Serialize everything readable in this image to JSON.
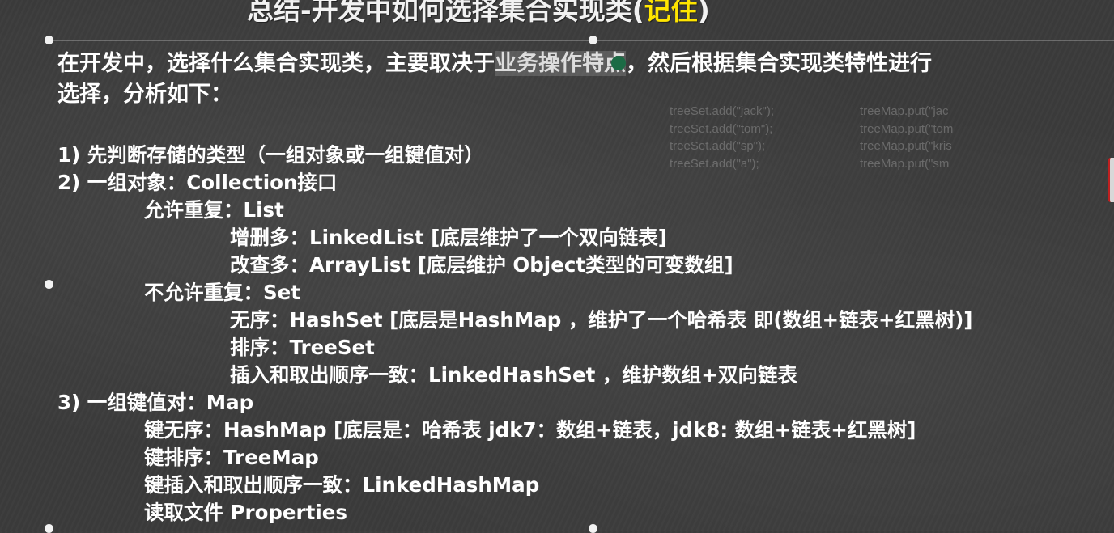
{
  "title": {
    "main": "总结-开发中如何选择集合实现类(",
    "highlight": "记住",
    "end": ")"
  },
  "intro": {
    "line1_a": "在开发中，选择什么集合实现类，主要取决于",
    "line1_selected": "业务操作特点",
    "line1_b": "，然后根据集合实现类特性进行",
    "line2": "选择，分析如下："
  },
  "code_left": [
    "treeSet.add(\"jack\");",
    "treeSet.add(\"tom\");",
    "treeSet.add(\"sp\");",
    "treeSet.add(\"a\");"
  ],
  "code_right": [
    "treeMap.put(\"jac",
    "treeMap.put(\"tom",
    "treeMap.put(\"kris",
    "treeMap.put(\"sm"
  ],
  "lines": [
    "1) 先判断存储的类型（一组对象或一组键值对）",
    "2) 一组对象：Collection接口",
    "允许重复：List",
    "增删多：LinkedList [底层维护了一个双向链表]",
    "改查多：ArrayList [底层维护 Object类型的可变数组]",
    "不允许重复：Set",
    "无序：HashSet  [底层是HashMap ，维护了一个哈希表  即(数组+链表+红黑树)]",
    "排序：TreeSet",
    "插入和取出顺序一致：LinkedHashSet ，维护数组+双向链表",
    "3) 一组键值对：Map",
    "键无序：HashMap [底层是：哈希表  jdk7：数组+链表，jdk8: 数组+链表+红黑树]",
    "键排序：TreeMap",
    "键插入和取出顺序一致：LinkedHashMap",
    "读取文件  Properties"
  ]
}
